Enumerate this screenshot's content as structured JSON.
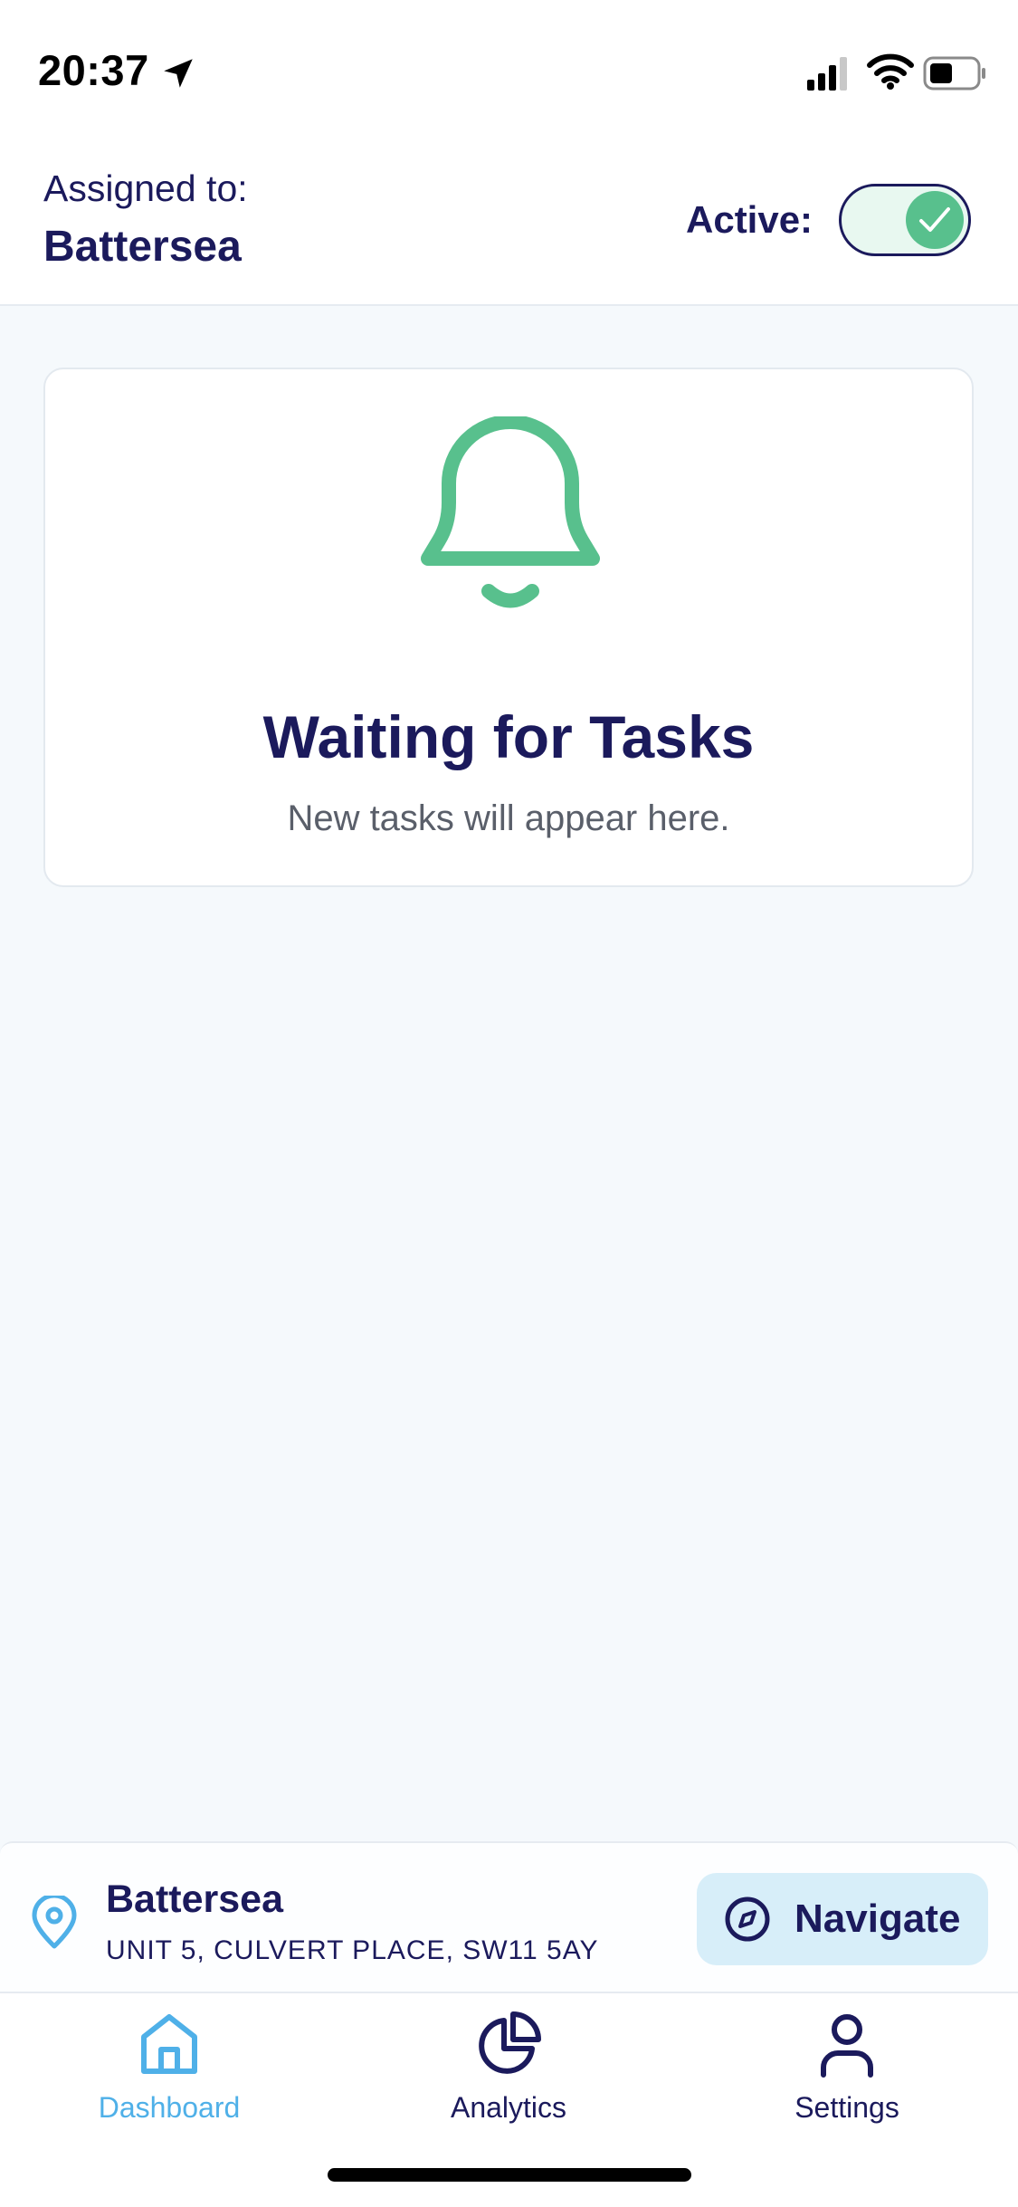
{
  "status_bar": {
    "time": "20:37",
    "location_icon": "location-arrow-icon",
    "signal_icon": "cellular-signal-icon",
    "wifi_icon": "wifi-icon",
    "battery_icon": "battery-icon"
  },
  "header": {
    "assigned_label": "Assigned to:",
    "assigned_value": "Battersea",
    "active_label": "Active:",
    "active_toggle_on": true
  },
  "empty_state": {
    "icon": "bell-icon",
    "title": "Waiting for Tasks",
    "subtitle": "New tasks will appear here."
  },
  "location": {
    "icon": "map-pin-icon",
    "name": "Battersea",
    "address": "UNIT 5, CULVERT PLACE, SW11 5AY",
    "navigate_label": "Navigate",
    "navigate_icon": "compass-icon"
  },
  "tabs": [
    {
      "label": "Dashboard",
      "icon": "home-icon",
      "active": true
    },
    {
      "label": "Analytics",
      "icon": "pie-chart-icon",
      "active": false
    },
    {
      "label": "Settings",
      "icon": "user-icon",
      "active": false
    }
  ],
  "colors": {
    "primary_navy": "#1b1a5c",
    "accent_green": "#58c08d",
    "accent_blue": "#4fb0e8",
    "navigate_bg": "#d7eef9",
    "background": "#f5f9fc"
  }
}
